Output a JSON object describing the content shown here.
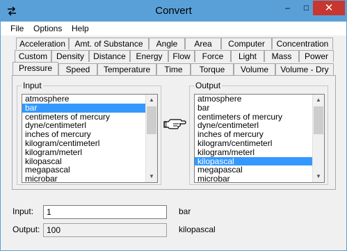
{
  "window": {
    "title": "Convert",
    "min_label": "–",
    "max_label": "□",
    "close_label": "✕"
  },
  "menu": [
    "File",
    "Options",
    "Help"
  ],
  "tabs": {
    "row1": [
      "Acceleration",
      "Amt. of Substance",
      "Angle",
      "Area",
      "Computer",
      "Concentration"
    ],
    "row2": [
      "Custom",
      "Density",
      "Distance",
      "Energy",
      "Flow",
      "Force",
      "Light",
      "Mass",
      "Power"
    ],
    "row3": [
      "Pressure",
      "Speed",
      "Temperature",
      "Time",
      "Torque",
      "Volume",
      "Volume - Dry"
    ],
    "active": "Pressure"
  },
  "input_group": {
    "label": "Input",
    "items": [
      "atmosphere",
      "bar",
      "centimeters of mercury",
      "dyne/centimeterl",
      "inches of mercury",
      "kilogram/centimeterl",
      "kilogram/meterl",
      "kilopascal",
      "megapascal",
      "microbar"
    ],
    "selected_index": 1
  },
  "output_group": {
    "label": "Output",
    "items": [
      "atmosphere",
      "bar",
      "centimeters of mercury",
      "dyne/centimeterl",
      "inches of mercury",
      "kilogram/centimeterl",
      "kilogram/meterl",
      "kilopascal",
      "megapascal",
      "microbar"
    ],
    "selected_index": 7
  },
  "input_field": {
    "label": "Input:",
    "value": "1",
    "unit": "bar"
  },
  "output_field": {
    "label": "Output:",
    "value": "100",
    "unit": "kilopascal"
  },
  "colors": {
    "titlebar": "#5aa0d8",
    "selection": "#3399ff",
    "close": "#c7372f"
  }
}
